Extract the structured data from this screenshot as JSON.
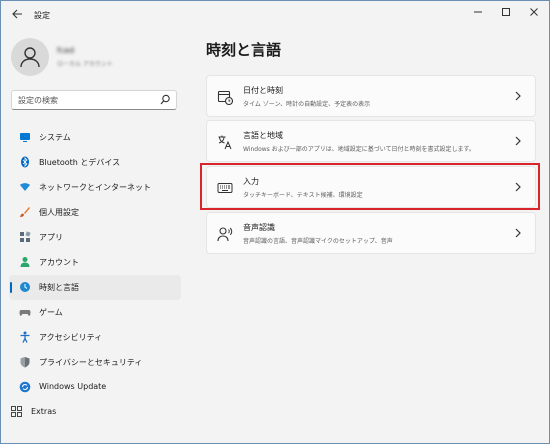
{
  "window": {
    "title": "設定"
  },
  "profile": {
    "name": "fced",
    "subtitle": "ローカル アカウント"
  },
  "search": {
    "placeholder": "設定の検索"
  },
  "sidebar": {
    "items": [
      {
        "label": "システム",
        "icon": "system-icon",
        "color": "#0078d4"
      },
      {
        "label": "Bluetooth とデバイス",
        "icon": "bluetooth-icon",
        "color": "#0067c0"
      },
      {
        "label": "ネットワークとインターネット",
        "icon": "network-icon",
        "color": "#1f8bd8"
      },
      {
        "label": "個人用設定",
        "icon": "brush-icon",
        "color": "#e57a2d"
      },
      {
        "label": "アプリ",
        "icon": "apps-icon",
        "color": "#5a6a7a"
      },
      {
        "label": "アカウント",
        "icon": "account-icon",
        "color": "#2aa66a"
      },
      {
        "label": "時刻と言語",
        "icon": "globe-clock-icon",
        "color": "#1e88d0",
        "active": true
      },
      {
        "label": "ゲーム",
        "icon": "gamepad-icon",
        "color": "#7a7a7a"
      },
      {
        "label": "アクセシビリティ",
        "icon": "accessibility-icon",
        "color": "#1f6fc4"
      },
      {
        "label": "プライバシーとセキュリティ",
        "icon": "shield-icon",
        "color": "#6b7178"
      },
      {
        "label": "Windows Update",
        "icon": "windows-update-icon",
        "color": "#1e78d0"
      }
    ],
    "extras": "Extras"
  },
  "main": {
    "title": "時刻と言語",
    "cards": [
      {
        "title": "日付と時刻",
        "subtitle": "タイム ゾーン、時計の自動設定、予定表の表示",
        "icon": "calendar-clock-icon"
      },
      {
        "title": "言語と地域",
        "subtitle": "Windows および一部のアプリは、地域設定に基づいて日付と時刻を書式設定します。",
        "icon": "language-icon"
      },
      {
        "title": "入力",
        "subtitle": "タッチキーボード、テキスト候補、環境設定",
        "icon": "keyboard-icon"
      },
      {
        "title": "音声認識",
        "subtitle": "音声認識の言語、音声認識マイクのセットアップ、音声",
        "icon": "speech-icon"
      }
    ]
  },
  "colors": {
    "accent": "#0067c0",
    "highlight": "#d9242b"
  }
}
